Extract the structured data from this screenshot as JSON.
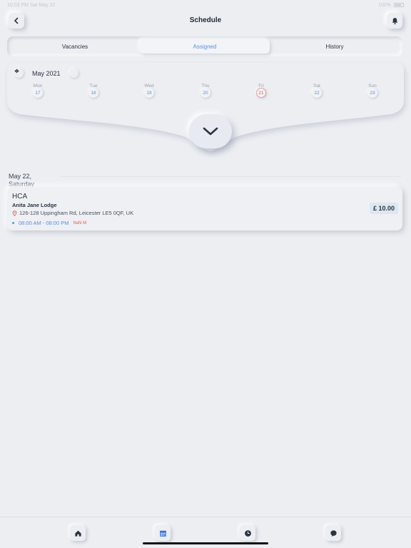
{
  "status_bar": {
    "time": "10:03 PM  Sat May 22",
    "battery": "100%"
  },
  "header": {
    "title": "Schedule",
    "back_icon": "chevron-left-icon",
    "bell_icon": "bell-icon"
  },
  "tabs": [
    {
      "label": "Vacancies",
      "active": false
    },
    {
      "label": "Assigned",
      "active": true
    },
    {
      "label": "History",
      "active": false
    }
  ],
  "calendar": {
    "month_label": "May 2021",
    "prev_icon": "arrow-left-icon",
    "next_icon": "arrow-right-icon",
    "expand_icon": "chevron-down-icon",
    "days": [
      {
        "name": "Mon",
        "num": "17"
      },
      {
        "name": "Tue",
        "num": "18"
      },
      {
        "name": "Wed",
        "num": "19"
      },
      {
        "name": "Thu",
        "num": "20"
      },
      {
        "name": "Fri",
        "num": "21"
      },
      {
        "name": "Sat",
        "num": "22"
      },
      {
        "name": "Sun",
        "num": "23"
      }
    ]
  },
  "schedule": {
    "date_line1": "May 22,",
    "date_line2": "Saturday",
    "shift": {
      "role": "HCA",
      "facility": "Anita Jane Lodge",
      "address": "126-128 Uppingham Rd, Leicester LE5 0QF, UK",
      "time": "08:00 AM - 08:00 PM",
      "tag": "NaN M",
      "price": "£ 10.00"
    }
  },
  "bottom_nav": [
    {
      "icon": "home-icon"
    },
    {
      "icon": "calendar-icon"
    },
    {
      "icon": "clock-icon"
    },
    {
      "icon": "chat-icon"
    }
  ],
  "colors": {
    "accent": "#5b8fe0",
    "today": "#e05b5b",
    "background": "#eceef2"
  }
}
